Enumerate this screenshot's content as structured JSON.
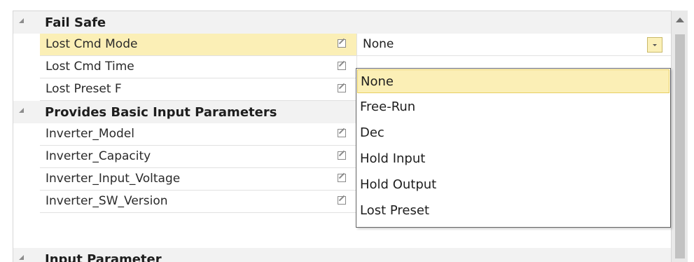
{
  "categories": [
    {
      "label": "Fail Safe"
    },
    {
      "label": "Provides Basic Input Parameters"
    },
    {
      "label": "Input Parameter"
    }
  ],
  "fail_safe_rows": [
    {
      "name": "Lost Cmd Mode",
      "value": "None"
    },
    {
      "name": "Lost Cmd Time",
      "value": ""
    },
    {
      "name": "Lost Preset F",
      "value": ""
    }
  ],
  "basic_rows": [
    {
      "name": "Inverter_Model"
    },
    {
      "name": "Inverter_Capacity"
    },
    {
      "name": "Inverter_Input_Voltage"
    },
    {
      "name": "Inverter_SW_Version"
    }
  ],
  "dropdown": {
    "options": [
      "None",
      "Free-Run",
      "Dec",
      "Hold Input",
      "Hold Output",
      "Lost Preset"
    ],
    "selected_index": 0
  },
  "colors": {
    "selection_bg": "#fbefb6",
    "category_bg": "#f2f2f2",
    "popup_border": "#646464"
  }
}
